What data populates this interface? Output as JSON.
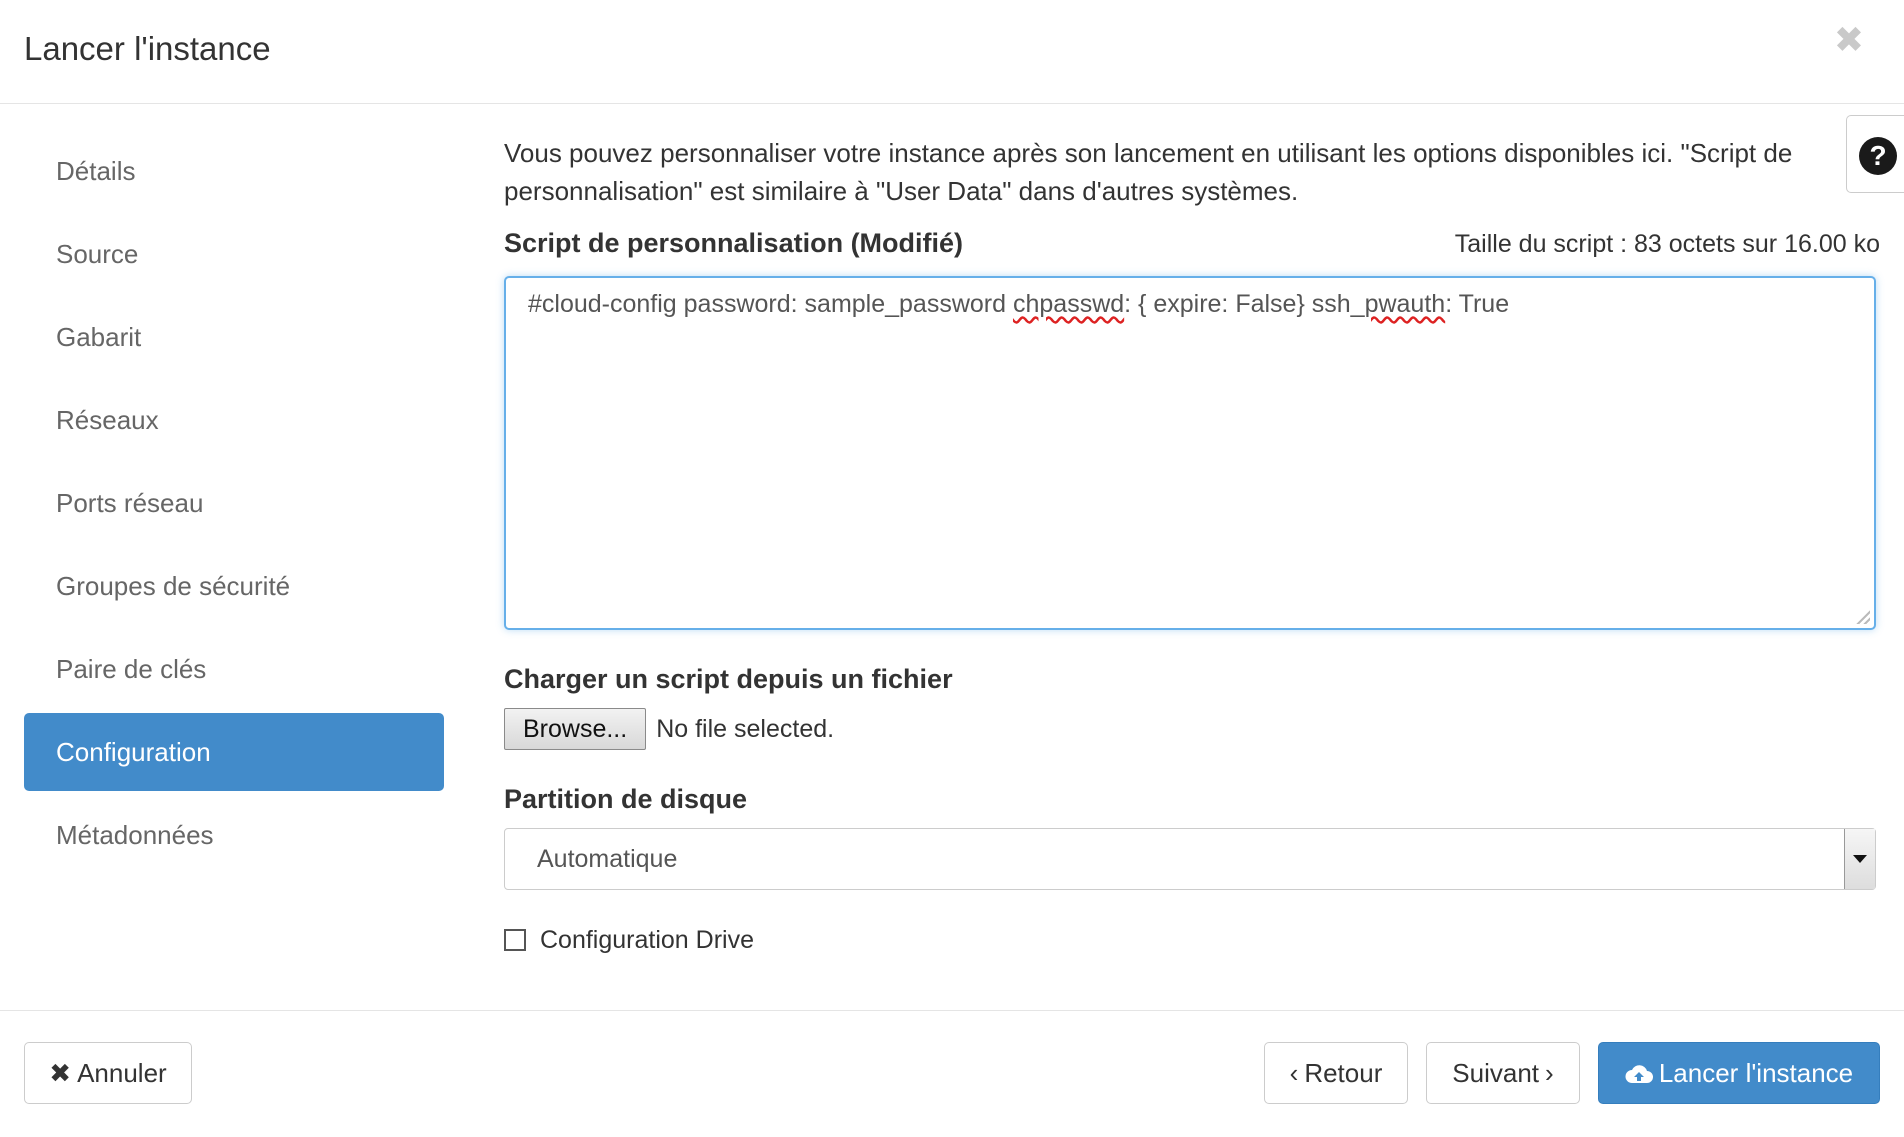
{
  "dialog": {
    "title": "Lancer l'instance",
    "close_glyph": "✖"
  },
  "sidebar": {
    "items": [
      {
        "label": "Détails"
      },
      {
        "label": "Source"
      },
      {
        "label": "Gabarit"
      },
      {
        "label": "Réseaux"
      },
      {
        "label": "Ports réseau"
      },
      {
        "label": "Groupes de sécurité"
      },
      {
        "label": "Paire de clés"
      },
      {
        "label": "Configuration",
        "active": true
      },
      {
        "label": "Métadonnées"
      }
    ]
  },
  "content": {
    "description": "Vous pouvez personnaliser votre instance après son lancement en utilisant les options disponibles ici. \"Script de personnalisation\" est similaire à \"User Data\" dans d'autres systèmes.",
    "help_icon": "question-circle-icon",
    "script_label": "Script de personnalisation (Modifié)",
    "script_size": "Taille du script : 83 octets sur 16.00 ko",
    "script_value": {
      "part1": "#cloud-config password: sample_password ",
      "part2": "chpasswd",
      "part3": ": { expire: False} ssh_",
      "part4": "pwauth",
      "part5": ": True"
    },
    "upload_label": "Charger un script depuis un fichier",
    "browse_label": "Browse...",
    "no_file": "No file selected.",
    "partition_label": "Partition de disque",
    "partition_value": "Automatique",
    "config_drive_label": "Configuration Drive",
    "config_drive_checked": false
  },
  "footer": {
    "cancel_label": "Annuler",
    "back_label": "Retour",
    "next_label": "Suivant",
    "launch_label": "Lancer l'instance"
  },
  "colors": {
    "accent": "#428bca",
    "text": "#333333",
    "muted": "#666666"
  }
}
